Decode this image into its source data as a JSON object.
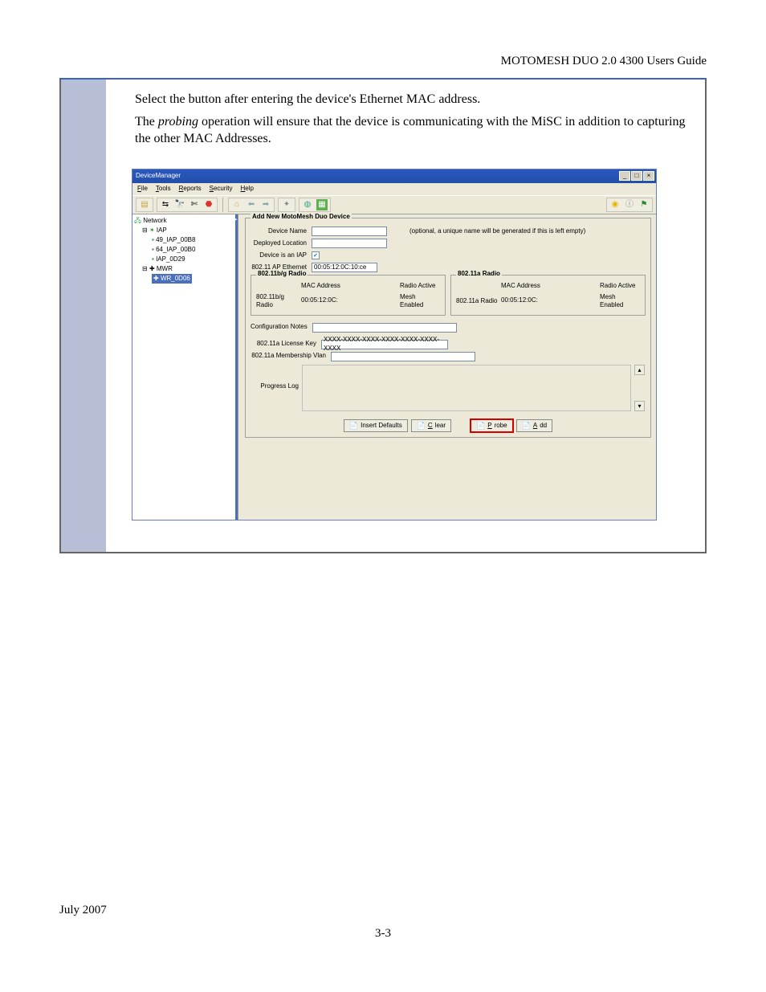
{
  "header": {
    "guide": "MOTOMESH DUO 2.0 4300 Users Guide"
  },
  "body": {
    "line1_pre": "Select the ",
    "line1_post": " button after entering the device's Ethernet MAC address.",
    "line2_pre": "The ",
    "line2_em": "probing",
    "line2_post": " operation will ensure that the device is communicating with the MiSC in addition to capturing the other MAC Addresses."
  },
  "shot": {
    "title": "DeviceManager",
    "menus": [
      "File",
      "Tools",
      "Reports",
      "Security",
      "Help"
    ],
    "tree": {
      "root": "Network",
      "groups": [
        {
          "label": "IAP",
          "items": [
            "49_IAP_00B8",
            "64_IAP_00B0",
            "IAP_0D29"
          ]
        },
        {
          "label": "MWR",
          "items": [
            "WR_0D06"
          ]
        }
      ]
    },
    "form": {
      "group_title": "Add New MotoMesh Duo Device",
      "device_name_lbl": "Device Name",
      "device_name_hint": "(optional, a unique name will be generated if this is left empty)",
      "deployed_lbl": "Deployed Location",
      "is_iap_lbl": "Device is an IAP",
      "ap_eth_lbl": "802.11 AP Ethernet",
      "ap_eth_val": "00:05:12:0C:10:ce",
      "bg_title": "802.11b/g Radio",
      "a_title": "802.11a Radio",
      "mac_lbl": "MAC Address",
      "radio_active_lbl": "Radio Active",
      "mesh_enabled_lbl": "Mesh Enabled",
      "bg_radio_lbl": "802.11b/g Radio",
      "a_radio_lbl": "802.11a Radio",
      "bg_radio_val": "00:05:12:0C:",
      "a_radio_val": "00:05:12:0C:",
      "conf_notes_lbl": "Configuration Notes",
      "license_lbl": "802.11a License Key",
      "license_val": "XXXX-XXXX-XXXX-XXXX-XXXX-XXXX-XXXX",
      "vlan_lbl": "802.11a Membership Vlan",
      "progress_lbl": "Progress Log",
      "btn_defaults": "Insert Defaults",
      "btn_clear": "Clear",
      "btn_probe": "Probe",
      "btn_add": "Add"
    }
  },
  "footer": {
    "date": "July 2007",
    "page": "3-3"
  }
}
